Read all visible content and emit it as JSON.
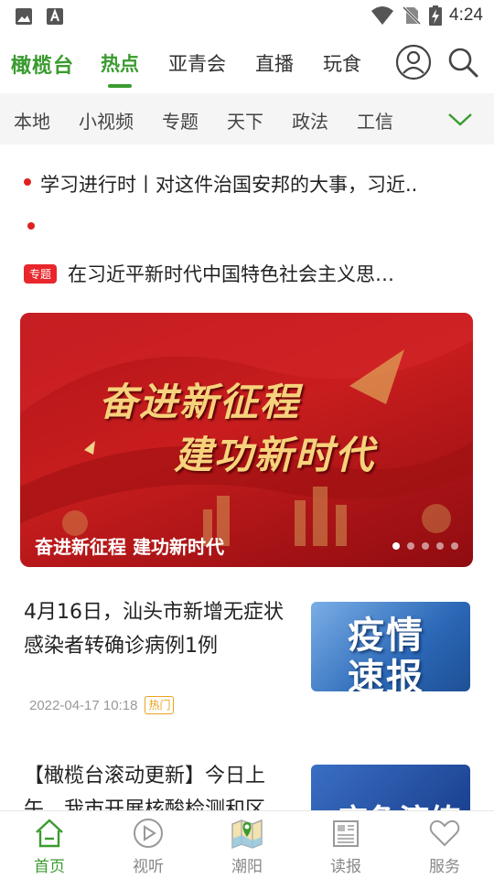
{
  "status_bar": {
    "time": "4:24",
    "icons": [
      "image-icon",
      "keyboard-a-icon",
      "wifi-icon",
      "no-sim-icon",
      "battery-charging-icon"
    ]
  },
  "header": {
    "brand": "橄榄台",
    "tabs": [
      {
        "label": "热点",
        "active": true
      },
      {
        "label": "亚青会",
        "active": false
      },
      {
        "label": "直播",
        "active": false
      },
      {
        "label": "玩食",
        "active": false
      }
    ],
    "icons": [
      "user-icon",
      "search-icon"
    ]
  },
  "channels": {
    "items": [
      "本地",
      "小视频",
      "专题",
      "天下",
      "政法",
      "工信"
    ],
    "more_icon": "chevron-down-icon"
  },
  "ticker": {
    "headline": "学习进行时丨对这件治国安邦的大事，习近.."
  },
  "topic": {
    "badge": "专题",
    "text": "在习近平新时代中国特色社会主义思…"
  },
  "banner": {
    "art_line1": "奋进新征程",
    "art_line2": "建功新时代",
    "caption": "奋进新征程 建功新时代",
    "slide_count": 5,
    "active_slide": 1
  },
  "news": [
    {
      "title": "4月16日，汕头市新增无症状感染者转确诊病例1例",
      "date": "2022-04-17 10:18",
      "tag": "热门",
      "thumb_line1": "疫情",
      "thumb_line2": "速报"
    },
    {
      "title": "【橄榄台滚动更新】今日上午，我市开展核酸检测和区",
      "thumb_text": "应急演练"
    }
  ],
  "bottom_nav": [
    {
      "label": "首页",
      "icon": "home-icon",
      "active": true
    },
    {
      "label": "视听",
      "icon": "play-icon",
      "active": false
    },
    {
      "label": "潮阳",
      "icon": "map-icon",
      "active": false
    },
    {
      "label": "读报",
      "icon": "newspaper-icon",
      "active": false
    },
    {
      "label": "服务",
      "icon": "heart-icon",
      "active": false
    }
  ],
  "colors": {
    "accent": "#3a9b2f",
    "badge_red": "#e8262b",
    "hot_orange": "#e8a31c"
  }
}
